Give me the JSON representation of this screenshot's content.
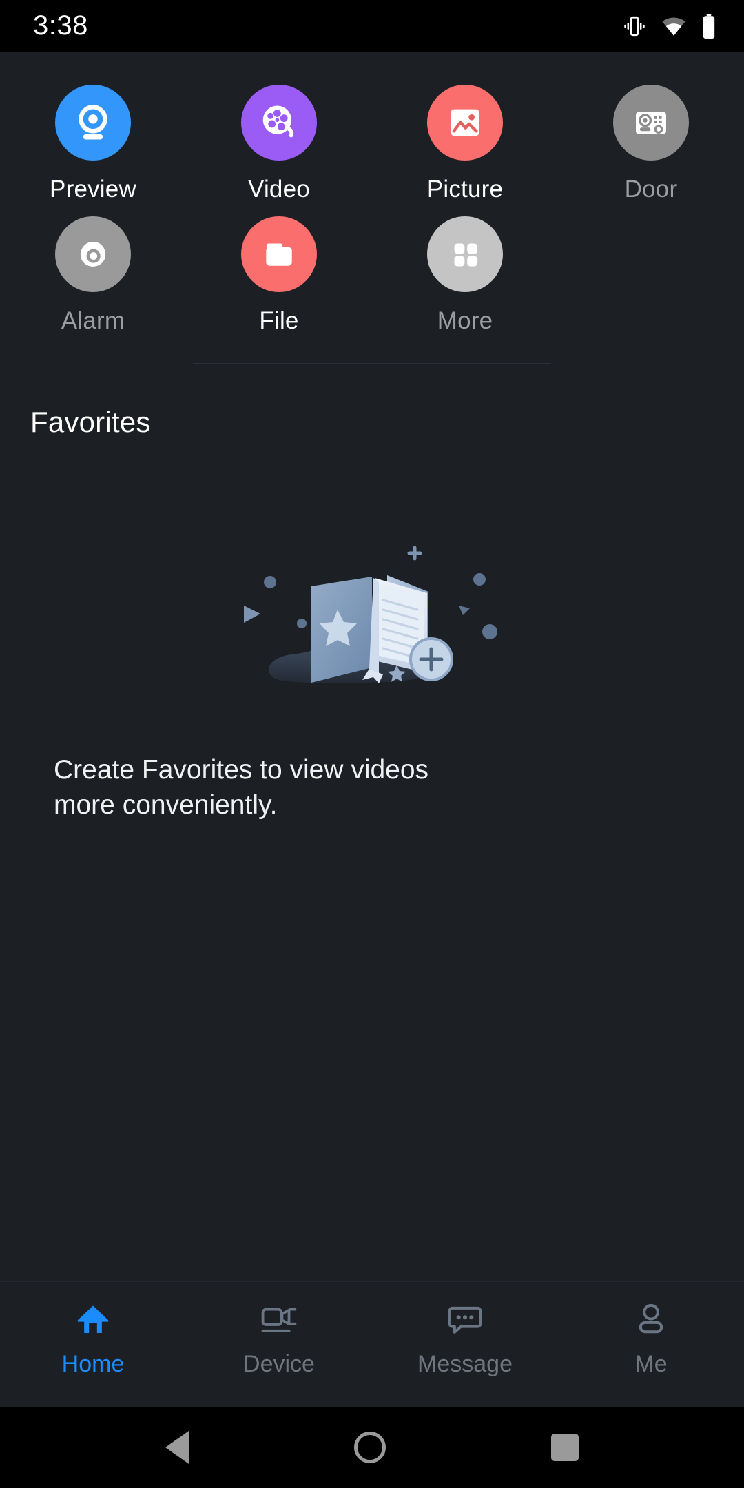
{
  "status_bar": {
    "time": "3:38",
    "icons": [
      "vibrate-icon",
      "wifi-icon",
      "battery-icon"
    ]
  },
  "shortcuts": [
    {
      "label": "Preview",
      "icon": "webcam-icon",
      "bg": "#3296fa",
      "enabled": true
    },
    {
      "label": "Video",
      "icon": "film-reel-icon",
      "bg": "#9b5cf6",
      "enabled": true
    },
    {
      "label": "Picture",
      "icon": "photo-icon",
      "bg": "#fa6e6e",
      "enabled": true
    },
    {
      "label": "Door",
      "icon": "door-station-icon",
      "bg": "#8c8c8c",
      "enabled": false
    },
    {
      "label": "Alarm",
      "icon": "alarm-bell-icon",
      "bg": "#9a9a9a",
      "enabled": false
    },
    {
      "label": "File",
      "icon": "folder-icon",
      "bg": "#fa6e6e",
      "enabled": true
    },
    {
      "label": "More",
      "icon": "grid-apps-icon",
      "bg": "#c4c4c4",
      "enabled": false
    }
  ],
  "favorites": {
    "title": "Favorites",
    "empty_illustration": "favorites-book-illustration",
    "empty_message": "Create Favorites to view videos more conveniently."
  },
  "tab_bar": {
    "items": [
      {
        "label": "Home",
        "icon": "home-icon",
        "active": true
      },
      {
        "label": "Device",
        "icon": "camera-icon",
        "active": false
      },
      {
        "label": "Message",
        "icon": "chat-icon",
        "active": false
      },
      {
        "label": "Me",
        "icon": "person-icon",
        "active": false
      }
    ]
  },
  "system_nav": {
    "back": "back-triangle-icon",
    "home": "home-circle-icon",
    "recents": "recents-square-icon"
  },
  "colors": {
    "background": "#1c1f24",
    "accent": "#1a8cff",
    "muted_text": "#9b9da1",
    "white_text": "#ffffff"
  }
}
